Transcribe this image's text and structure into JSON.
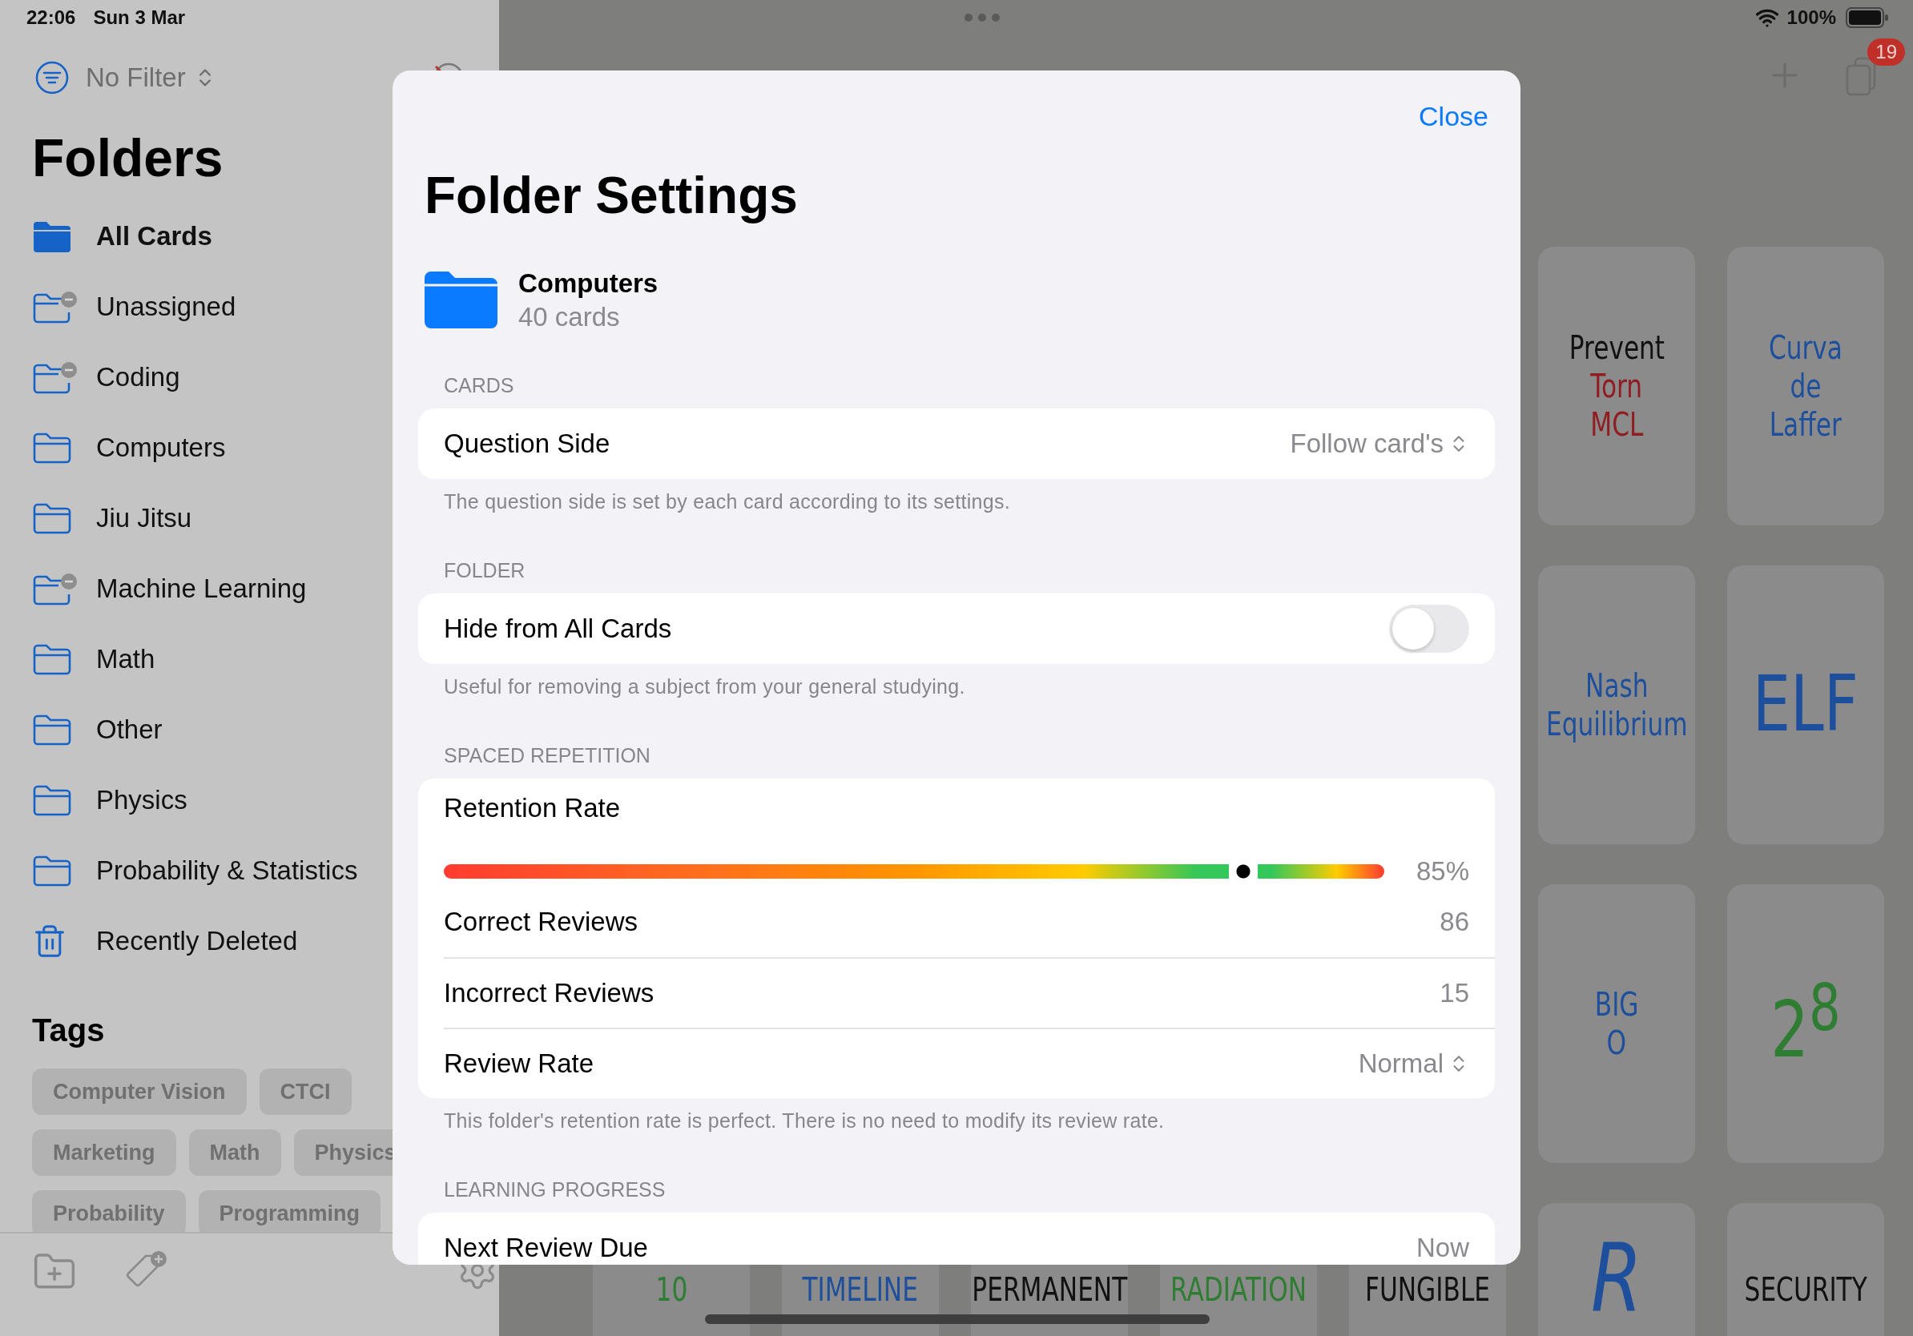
{
  "status_bar": {
    "time": "22:06",
    "date": "Sun 3 Mar",
    "battery": "100%"
  },
  "sidebar": {
    "filter": "No Filter",
    "title": "Folders",
    "folders": [
      {
        "label": "All Cards",
        "kind": "folder",
        "selected": true
      },
      {
        "label": "Unassigned",
        "kind": "smart-folder",
        "selected": false
      },
      {
        "label": "Coding",
        "kind": "smart-folder",
        "selected": false
      },
      {
        "label": "Computers",
        "kind": "folder",
        "selected": false
      },
      {
        "label": "Jiu Jitsu",
        "kind": "folder",
        "selected": false
      },
      {
        "label": "Machine Learning",
        "kind": "smart-folder",
        "selected": false
      },
      {
        "label": "Math",
        "kind": "folder",
        "selected": false
      },
      {
        "label": "Other",
        "kind": "folder",
        "selected": false
      },
      {
        "label": "Physics",
        "kind": "folder",
        "selected": false
      },
      {
        "label": "Probability & Statistics",
        "kind": "folder",
        "selected": false
      },
      {
        "label": "Recently Deleted",
        "kind": "trash",
        "selected": false
      }
    ],
    "tags_title": "Tags",
    "tag_rows": [
      [
        "Computer Vision",
        "CTCI"
      ],
      [
        "Marketing",
        "Math",
        "Physics"
      ],
      [
        "Probability",
        "Programming"
      ]
    ]
  },
  "deck_badge": "19",
  "card_rows": [
    [
      {
        "kind": "words",
        "lines": [
          {
            "text": "Prevent",
            "color": "#111111"
          },
          {
            "text": "Torn",
            "color": "#8f1d22"
          },
          {
            "text": "MCL",
            "color": "#8f1d22"
          }
        ]
      },
      {
        "kind": "words",
        "lines": [
          {
            "text": "Curva",
            "color": "#1d4f9c"
          },
          {
            "text": "de",
            "color": "#1d4f9c"
          },
          {
            "text": "Laffer",
            "color": "#1d4f9c"
          }
        ]
      }
    ],
    [
      {
        "kind": "words",
        "lines": [
          {
            "text": "Nash",
            "color": "#1d4f9c"
          },
          {
            "text": "Equilibrium",
            "color": "#1d4f9c"
          }
        ]
      },
      {
        "kind": "large",
        "lines": [
          {
            "text": "ELF",
            "color": "#1d4f9c"
          }
        ]
      }
    ],
    [
      {
        "kind": "words",
        "lines": [
          {
            "text": "BIG",
            "color": "#1d4f9c"
          },
          {
            "text": "O",
            "color": "#1d4f9c"
          }
        ]
      },
      {
        "kind": "large",
        "lines": [
          {
            "text": "2$^{8}$",
            "color": "#2e7d32"
          }
        ]
      }
    ]
  ],
  "bottom_cards": [
    {
      "kind": "words",
      "lines": [
        {
          "text": "10",
          "color": "#2e7d32"
        }
      ]
    },
    {
      "kind": "words",
      "lines": [
        {
          "text": "TIMELINE",
          "color": "#1d4f9c"
        }
      ]
    },
    {
      "kind": "words",
      "lines": [
        {
          "text": "PERMANENT",
          "color": "#111111"
        }
      ]
    },
    {
      "kind": "words",
      "lines": [
        {
          "text": "RADIATION",
          "color": "#2e7d32"
        }
      ]
    },
    {
      "kind": "words",
      "lines": [
        {
          "text": "FUNGIBLE",
          "color": "#111111"
        }
      ]
    },
    {
      "kind": "script",
      "lines": [
        {
          "text": "R",
          "color": "#1d4f9c"
        }
      ]
    },
    {
      "kind": "words",
      "lines": [
        {
          "text": "SECURITY",
          "color": "#111111"
        }
      ]
    }
  ],
  "modal": {
    "close": "Close",
    "title": "Folder Settings",
    "folder": {
      "name": "Computers",
      "count": "40 cards"
    },
    "sections": [
      {
        "header": "CARDS",
        "rows": [
          {
            "kind": "picker",
            "label": "Question Side",
            "value": "Follow card's"
          }
        ],
        "footer": "The question side is set by each card according to its settings."
      },
      {
        "header": "FOLDER",
        "rows": [
          {
            "kind": "toggle",
            "label": "Hide from All Cards",
            "on": false
          }
        ],
        "footer": "Useful for removing a subject from your general studying."
      },
      {
        "header": "SPACED REPETITION",
        "rows": [
          {
            "kind": "slider",
            "label": "Retention Rate",
            "level": 0.85,
            "reading": "85%"
          },
          {
            "kind": "value",
            "label": "Correct Reviews",
            "value": "86"
          },
          {
            "kind": "value",
            "label": "Incorrect Reviews",
            "value": "15"
          },
          {
            "kind": "picker",
            "label": "Review Rate",
            "value": "Normal"
          }
        ],
        "footer": "This folder's retention rate is perfect. There is no need to modify its review rate."
      },
      {
        "header": "LEARNING PROGRESS",
        "rows": [
          {
            "kind": "value",
            "label": "Next Review Due",
            "value": "Now"
          }
        ]
      }
    ]
  }
}
